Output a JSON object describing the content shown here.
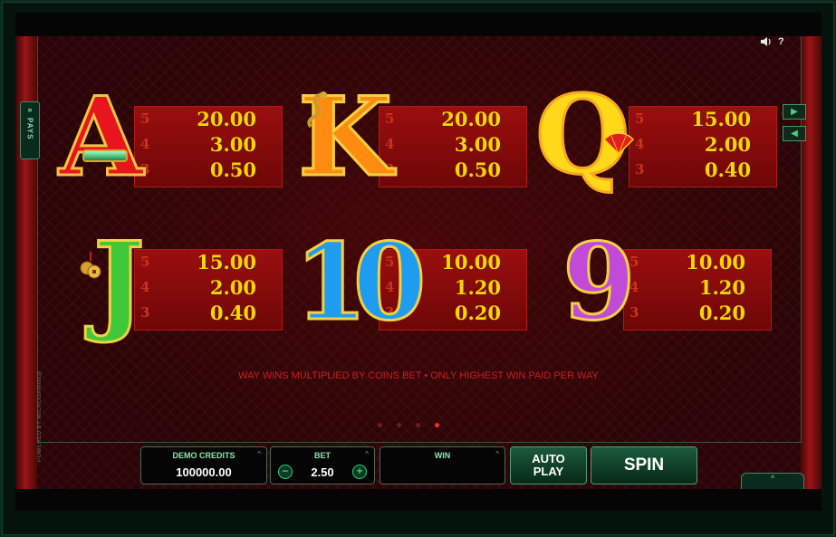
{
  "sound_icon": "speaker-icon",
  "help_label": "?",
  "pays_tab": {
    "chevron": "»",
    "label": "PAYS"
  },
  "powered_by": "POWERED BY MICROGAMING™",
  "nav": {
    "next": "▶",
    "prev": "◀"
  },
  "symbols": [
    {
      "name": "A",
      "glyph": "A",
      "color": "#e8141e",
      "pays": [
        {
          "count": "5",
          "value": "20.00"
        },
        {
          "count": "4",
          "value": "3.00"
        },
        {
          "count": "3",
          "value": "0.50"
        }
      ]
    },
    {
      "name": "K",
      "glyph": "K",
      "color": "#ff8c10",
      "pays": [
        {
          "count": "5",
          "value": "20.00"
        },
        {
          "count": "4",
          "value": "3.00"
        },
        {
          "count": "3",
          "value": "0.50"
        }
      ]
    },
    {
      "name": "Q",
      "glyph": "Q",
      "color": "#ffd81a",
      "pays": [
        {
          "count": "5",
          "value": "15.00"
        },
        {
          "count": "4",
          "value": "2.00"
        },
        {
          "count": "3",
          "value": "0.40"
        }
      ]
    },
    {
      "name": "J",
      "glyph": "J",
      "color": "#3ec83a",
      "pays": [
        {
          "count": "5",
          "value": "15.00"
        },
        {
          "count": "4",
          "value": "2.00"
        },
        {
          "count": "3",
          "value": "0.40"
        }
      ]
    },
    {
      "name": "10",
      "glyph": "10",
      "color": "#1e9cf0",
      "pays": [
        {
          "count": "5",
          "value": "10.00"
        },
        {
          "count": "4",
          "value": "1.20"
        },
        {
          "count": "3",
          "value": "0.20"
        }
      ]
    },
    {
      "name": "9",
      "glyph": "9",
      "color": "#c24ad8",
      "pays": [
        {
          "count": "5",
          "value": "10.00"
        },
        {
          "count": "4",
          "value": "1.20"
        },
        {
          "count": "3",
          "value": "0.20"
        }
      ]
    }
  ],
  "wins_note": "WAY WINS MULTIPLIED BY COINS BET  •  ONLY HIGHEST WIN PAID PER WAY",
  "page_dots": {
    "count": 4,
    "active": 4
  },
  "controls": {
    "demo_credits_label": "DEMO CREDITS",
    "demo_credits_value": "100000.00",
    "bet_label": "BET",
    "bet_value": "2.50",
    "minus": "−",
    "plus": "+",
    "win_label": "WIN",
    "win_value": "",
    "auto_play_line1": "AUTO",
    "auto_play_line2": "PLAY",
    "spin_label": "SPIN",
    "caret": "^",
    "corner_caret": "^"
  }
}
